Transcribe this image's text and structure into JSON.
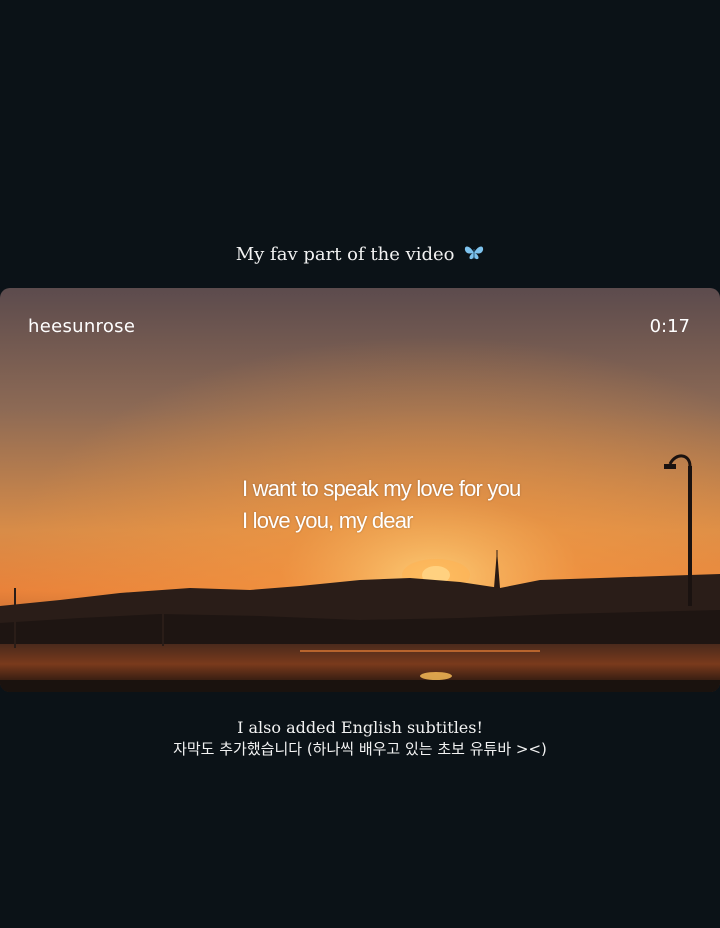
{
  "story": {
    "caption_top": "My fav part of the video",
    "caption_top_icon": "butterfly-icon",
    "video": {
      "uploader": "heesunrose",
      "timestamp": "0:17",
      "subtitle_line1": "I want to speak my love for you",
      "subtitle_line2": "I love you, my dear"
    },
    "caption_bottom_line1": "I also added English subtitles!",
    "caption_bottom_line2": "자막도 추가했습니다 (하나씩 배우고 있는 초보 유튜바 ><)"
  },
  "colors": {
    "background": "#0b1217",
    "sky_top": "#5a4a4c",
    "sky_glow": "#f0a050",
    "sun": "#ffe38a",
    "butterfly": "#7ec3ee"
  }
}
